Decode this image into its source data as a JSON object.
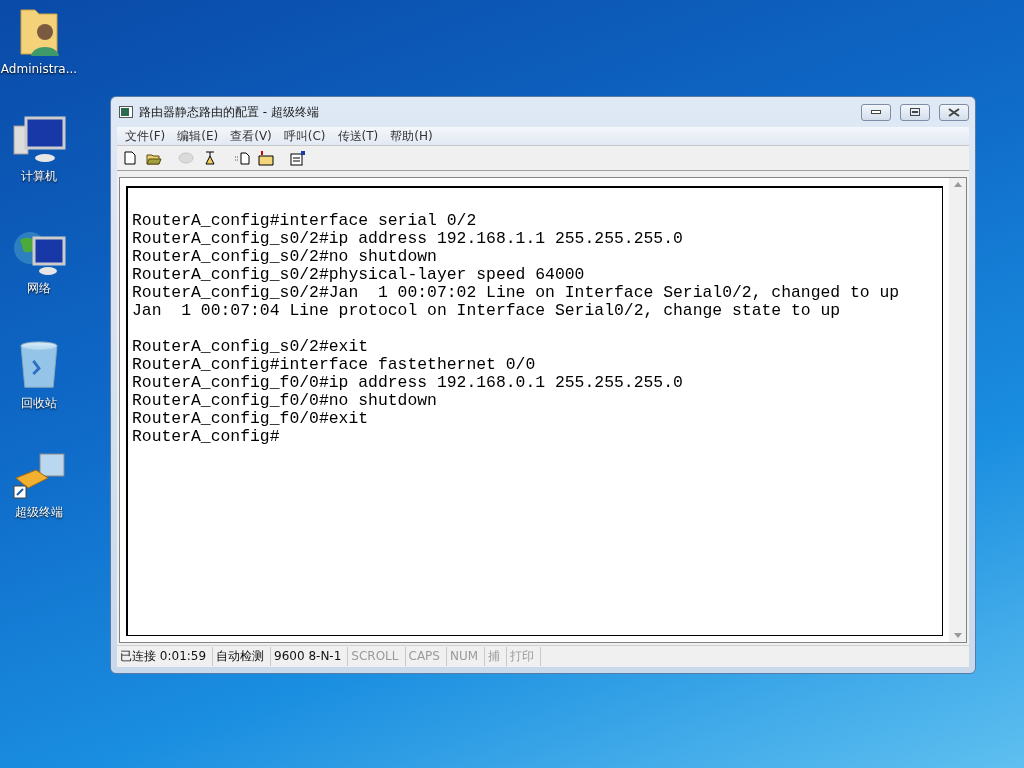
{
  "desktop_icons": [
    {
      "kind": "user-folder",
      "label": "Administra..."
    },
    {
      "kind": "computer",
      "label": "计算机"
    },
    {
      "kind": "network",
      "label": "网络"
    },
    {
      "kind": "recycle-bin",
      "label": "回收站"
    },
    {
      "kind": "terminal",
      "label": "超级终端"
    }
  ],
  "window": {
    "title": "路由器静态路由的配置 - 超级终端",
    "menu": [
      "文件(F)",
      "编辑(E)",
      "查看(V)",
      "呼叫(C)",
      "传送(T)",
      "帮助(H)"
    ],
    "toolbar": [
      {
        "kind": "new",
        "disabled": false
      },
      {
        "kind": "open",
        "disabled": false
      },
      {
        "kind": "call",
        "disabled": true
      },
      {
        "kind": "disconnect",
        "disabled": false
      },
      {
        "kind": "send",
        "disabled": false
      },
      {
        "kind": "receive",
        "disabled": false
      },
      {
        "kind": "properties",
        "disabled": false
      }
    ],
    "terminal_blocks": [
      [
        "RouterA_config#interface serial 0/2",
        "RouterA_config_s0/2#ip address 192.168.1.1 255.255.255.0",
        "RouterA_config_s0/2#no shutdown",
        "RouterA_config_s0/2#physical-layer speed 64000",
        "RouterA_config_s0/2#Jan  1 00:07:02 Line on Interface Serial0/2, changed to up",
        "Jan  1 00:07:04 Line protocol on Interface Serial0/2, change state to up"
      ],
      [
        "RouterA_config_s0/2#exit",
        "RouterA_config#interface fastethernet 0/0",
        "RouterA_config_f0/0#ip address 192.168.0.1 255.255.255.0",
        "RouterA_config_f0/0#no shutdown",
        "RouterA_config_f0/0#exit",
        "RouterA_config#"
      ]
    ],
    "status_bar": [
      {
        "text": "已连接 0:01:59",
        "active": true
      },
      {
        "text": "自动检测",
        "active": true
      },
      {
        "text": "9600 8-N-1",
        "active": true
      },
      {
        "text": "SCROLL",
        "active": false
      },
      {
        "text": "CAPS",
        "active": false
      },
      {
        "text": "NUM",
        "active": false
      },
      {
        "text": "捕",
        "active": false
      },
      {
        "text": "打印",
        "active": false
      }
    ]
  }
}
